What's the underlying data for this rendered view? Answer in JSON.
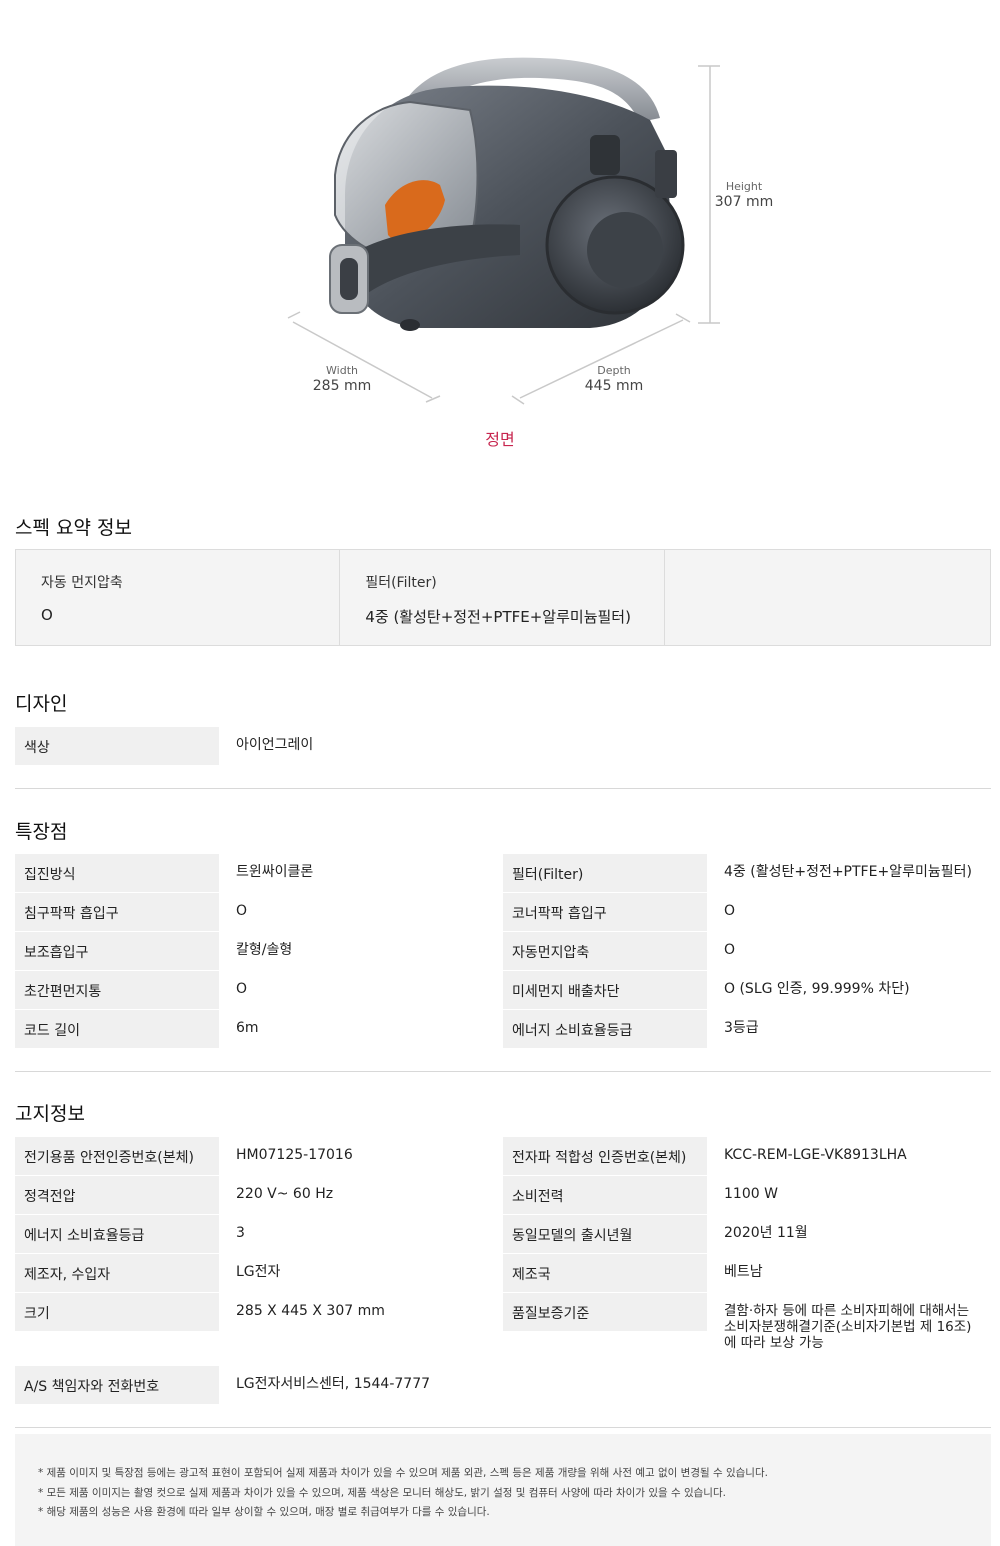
{
  "figure": {
    "height_caption": "Height",
    "height_value": "307 mm",
    "width_caption": "Width",
    "width_value": "285 mm",
    "depth_caption": "Depth",
    "depth_value": "445 mm",
    "view_label": "정면"
  },
  "summary": {
    "title": "스펙 요약 정보",
    "items": [
      {
        "label": "자동 먼지압축",
        "value": "O"
      },
      {
        "label": "필터(Filter)",
        "value": "4중 (활성탄+정전+PTFE+알루미늄필터)"
      },
      {
        "label": "",
        "value": ""
      }
    ]
  },
  "design": {
    "title": "디자인",
    "rows": [
      {
        "label": "색상",
        "value": "아이언그레이"
      }
    ]
  },
  "features": {
    "title": "특장점",
    "left": [
      {
        "label": "집진방식",
        "value": "트윈싸이클론"
      },
      {
        "label": "침구팍팍 흡입구",
        "value": "O"
      },
      {
        "label": "보조흡입구",
        "value": "칼형/솔형"
      },
      {
        "label": "초간편먼지통",
        "value": "O"
      },
      {
        "label": "코드 길이",
        "value": "6m"
      }
    ],
    "right": [
      {
        "label": "필터(Filter)",
        "value": "4중 (활성탄+정전+PTFE+알루미늄필터)"
      },
      {
        "label": "코너팍팍 흡입구",
        "value": "O"
      },
      {
        "label": "자동먼지압축",
        "value": "O"
      },
      {
        "label": "미세먼지 배출차단",
        "value": "O  (SLG 인증, 99.999% 차단)"
      },
      {
        "label": "에너지 소비효율등급",
        "value": "3등급"
      }
    ]
  },
  "notice_info": {
    "title": "고지정보",
    "left": [
      {
        "label": "전기용품 안전인증번호(본체)",
        "value": "HM07125-17016"
      },
      {
        "label": "정격전압",
        "value": "220 V~ 60 Hz"
      },
      {
        "label": "에너지 소비효율등급",
        "value": "3"
      },
      {
        "label": "제조자, 수입자",
        "value": "LG전자"
      },
      {
        "label": "크기",
        "value": "285 X 445 X 307 mm"
      }
    ],
    "right": [
      {
        "label": "전자파 적합성 인증번호(본체)",
        "value": "KCC-REM-LGE-VK8913LHA"
      },
      {
        "label": "소비전력",
        "value": "1100 W"
      },
      {
        "label": "동일모델의 출시년월",
        "value": "2020년 11월"
      },
      {
        "label": "제조국",
        "value": "베트남"
      },
      {
        "label": "품질보증기준",
        "value": "결함·하자 등에 따른 소비자피해에 대해서는 소비자분쟁해결기준(소비자기본법 제 16조)에 따라 보상 가능"
      }
    ],
    "as_row": {
      "label": "A/S 책임자와 전화번호",
      "value": "LG전자서비스센터, 1544-7777"
    }
  },
  "disclaimers": [
    "제품 이미지 및 특장점 등에는 광고적 표현이 포함되어 실제 제품과 차이가 있을 수 있으며 제품 외관, 스펙 등은 제품 개량을 위해 사전 예고 없이 변경될 수 있습니다.",
    "모든 제품 이미지는 촬영 컷으로 실제 제품과 차이가 있을 수 있으며, 제품 색상은 모니터 해상도, 밝기 설정 및 컴퓨터 사양에 따라 차이가 있을 수 있습니다.",
    "해당 제품의 성능은 사용 환경에 따라 일부 상이할 수 있으며, 매장 별로 취급여부가 다를 수 있습니다."
  ],
  "colors": {
    "accent": "#c7254e",
    "product_body": "#4a4f57",
    "cyclone": "#d96a1c"
  }
}
